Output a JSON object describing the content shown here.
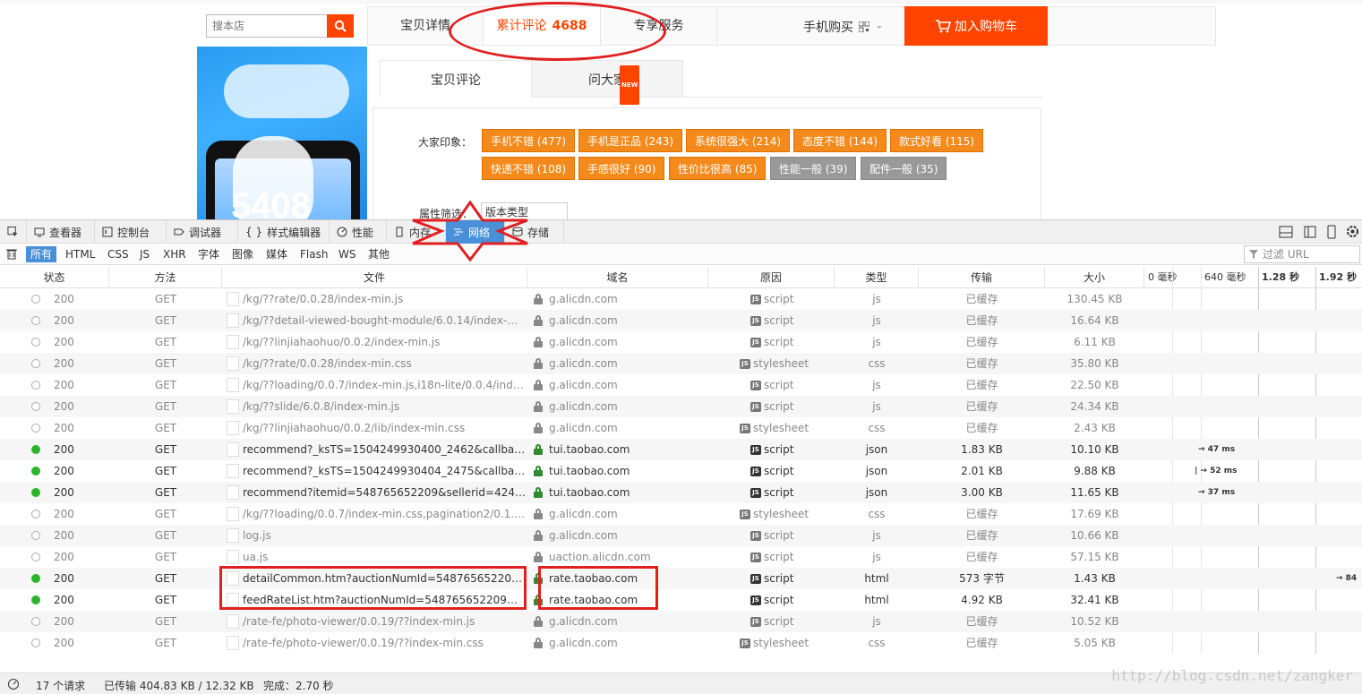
{
  "web": {
    "store_search_placeholder": "搜本店",
    "tabs": [
      {
        "label": "宝贝详情"
      },
      {
        "label": "累计评论",
        "count": "4688"
      },
      {
        "label": "专享服务"
      }
    ],
    "mobile_buy": "手机购买",
    "cart_label": "加入购物车",
    "product_price": "5408",
    "subtabs": [
      {
        "label": "宝贝评论"
      },
      {
        "label": "问大家",
        "badge": "NEW"
      }
    ],
    "impression_label": "大家印象：",
    "tags_row1": [
      "手机不错 (477)",
      "手机是正品 (243)",
      "系统很强大 (214)",
      "态度不错 (144)",
      "款式好看 (115)"
    ],
    "tags_row2": [
      "快递不错 (108)",
      "手感很好 (90)",
      "性价比很高 (85)",
      "性能一般 (39)",
      "配件一般 (35)"
    ],
    "filter_label": "属性筛选：",
    "filter_value": "版本类型"
  },
  "devtools": {
    "tabs": [
      "查看器",
      "控制台",
      "调试器",
      "样式编辑器",
      "性能",
      "内存",
      "网络",
      "存储"
    ],
    "active_tab": "网络",
    "filters": [
      "所有",
      "HTML",
      "CSS",
      "JS",
      "XHR",
      "字体",
      "图像",
      "媒体",
      "Flash",
      "WS",
      "其他"
    ],
    "filter_url_placeholder": "过滤 URL",
    "columns": [
      "状态",
      "方法",
      "文件",
      "域名",
      "原因",
      "类型",
      "传输",
      "大小"
    ],
    "waterfall_ticks": [
      "0 毫秒",
      "640 毫秒",
      "1.28 秒",
      "1.92 秒"
    ],
    "requests": [
      {
        "status": "200",
        "method": "GET",
        "file": "/kg/??rate/0.0.28/index-min.js",
        "domain": "g.alicdn.com",
        "cause": "script",
        "type": "js",
        "transferred": "已缓存",
        "size": "130.45 KB",
        "cached": true,
        "timing": ""
      },
      {
        "status": "200",
        "method": "GET",
        "file": "/kg/??detail-viewed-bought-module/6.0.14/index-mi...",
        "domain": "g.alicdn.com",
        "cause": "script",
        "type": "js",
        "transferred": "已缓存",
        "size": "16.64 KB",
        "cached": true,
        "timing": ""
      },
      {
        "status": "200",
        "method": "GET",
        "file": "/kg/??linjiahaohuo/0.0.2/index-min.js",
        "domain": "g.alicdn.com",
        "cause": "script",
        "type": "js",
        "transferred": "已缓存",
        "size": "6.11 KB",
        "cached": true,
        "timing": ""
      },
      {
        "status": "200",
        "method": "GET",
        "file": "/kg/??rate/0.0.28/index-min.css",
        "domain": "g.alicdn.com",
        "cause": "stylesheet",
        "type": "css",
        "transferred": "已缓存",
        "size": "35.80 KB",
        "cached": true,
        "timing": ""
      },
      {
        "status": "200",
        "method": "GET",
        "file": "/kg/??loading/0.0.7/index-min.js,i18n-lite/0.0.4/index...",
        "domain": "g.alicdn.com",
        "cause": "script",
        "type": "js",
        "transferred": "已缓存",
        "size": "22.50 KB",
        "cached": true,
        "timing": ""
      },
      {
        "status": "200",
        "method": "GET",
        "file": "/kg/??slide/6.0.8/index-min.js",
        "domain": "g.alicdn.com",
        "cause": "script",
        "type": "js",
        "transferred": "已缓存",
        "size": "24.34 KB",
        "cached": true,
        "timing": ""
      },
      {
        "status": "200",
        "method": "GET",
        "file": "/kg/??linjiahaohuo/0.0.2/lib/index-min.css",
        "domain": "g.alicdn.com",
        "cause": "stylesheet",
        "type": "css",
        "transferred": "已缓存",
        "size": "2.43 KB",
        "cached": true,
        "timing": ""
      },
      {
        "status": "200",
        "method": "GET",
        "file": "recommend?_ksTS=1504249930400_2462&callback=...",
        "domain": "tui.taobao.com",
        "cause": "script",
        "type": "json",
        "transferred": "1.83 KB",
        "size": "10.10 KB",
        "cached": false,
        "timing": "→ 47 ms"
      },
      {
        "status": "200",
        "method": "GET",
        "file": "recommend?_ksTS=1504249930404_2475&callback=...",
        "domain": "tui.taobao.com",
        "cause": "script",
        "type": "json",
        "transferred": "2.01 KB",
        "size": "9.88 KB",
        "cached": false,
        "timing": "| → 52 ms"
      },
      {
        "status": "200",
        "method": "GET",
        "file": "recommend?itemid=548765652209&sellerid=424280...",
        "domain": "tui.taobao.com",
        "cause": "script",
        "type": "json",
        "transferred": "3.00 KB",
        "size": "11.65 KB",
        "cached": false,
        "timing": "→ 37 ms"
      },
      {
        "status": "200",
        "method": "GET",
        "file": "/kg/??loading/0.0.7/index-min.css,pagination2/0.1.3/i...",
        "domain": "g.alicdn.com",
        "cause": "stylesheet",
        "type": "css",
        "transferred": "已缓存",
        "size": "17.69 KB",
        "cached": true,
        "timing": ""
      },
      {
        "status": "200",
        "method": "GET",
        "file": "log.js",
        "domain": "g.alicdn.com",
        "cause": "script",
        "type": "js",
        "transferred": "已缓存",
        "size": "10.66 KB",
        "cached": true,
        "timing": ""
      },
      {
        "status": "200",
        "method": "GET",
        "file": "ua.js",
        "domain": "uaction.alicdn.com",
        "cause": "script",
        "type": "js",
        "transferred": "已缓存",
        "size": "57.15 KB",
        "cached": true,
        "timing": ""
      },
      {
        "status": "200",
        "method": "GET",
        "file": "detailCommon.htm?auctionNumId=548765652209&...",
        "domain": "rate.taobao.com",
        "cause": "script",
        "type": "html",
        "transferred": "573 字节",
        "size": "1.43 KB",
        "cached": false,
        "timing": "→ 84"
      },
      {
        "status": "200",
        "method": "GET",
        "file": "feedRateList.htm?auctionNumId=548765652209&use...",
        "domain": "rate.taobao.com",
        "cause": "script",
        "type": "html",
        "transferred": "4.92 KB",
        "size": "32.41 KB",
        "cached": false,
        "timing": ""
      },
      {
        "status": "200",
        "method": "GET",
        "file": "/rate-fe/photo-viewer/0.0.19/??index-min.js",
        "domain": "g.alicdn.com",
        "cause": "script",
        "type": "js",
        "transferred": "已缓存",
        "size": "10.52 KB",
        "cached": true,
        "timing": ""
      },
      {
        "status": "200",
        "method": "GET",
        "file": "/rate-fe/photo-viewer/0.0.19/??index-min.css",
        "domain": "g.alicdn.com",
        "cause": "stylesheet",
        "type": "css",
        "transferred": "已缓存",
        "size": "5.05 KB",
        "cached": true,
        "timing": ""
      }
    ],
    "status_requests": "17 个请求",
    "status_transferred": "已传输 404.83 KB / 12.32 KB",
    "status_finish": "完成：2.70 秒"
  },
  "watermark": "http://blog.csdn.net/zangker",
  "colors": {
    "accent": "#ff4400",
    "annotation": "#e02020",
    "active_tab": "#4a90d9",
    "tag": "#f48a1c"
  }
}
